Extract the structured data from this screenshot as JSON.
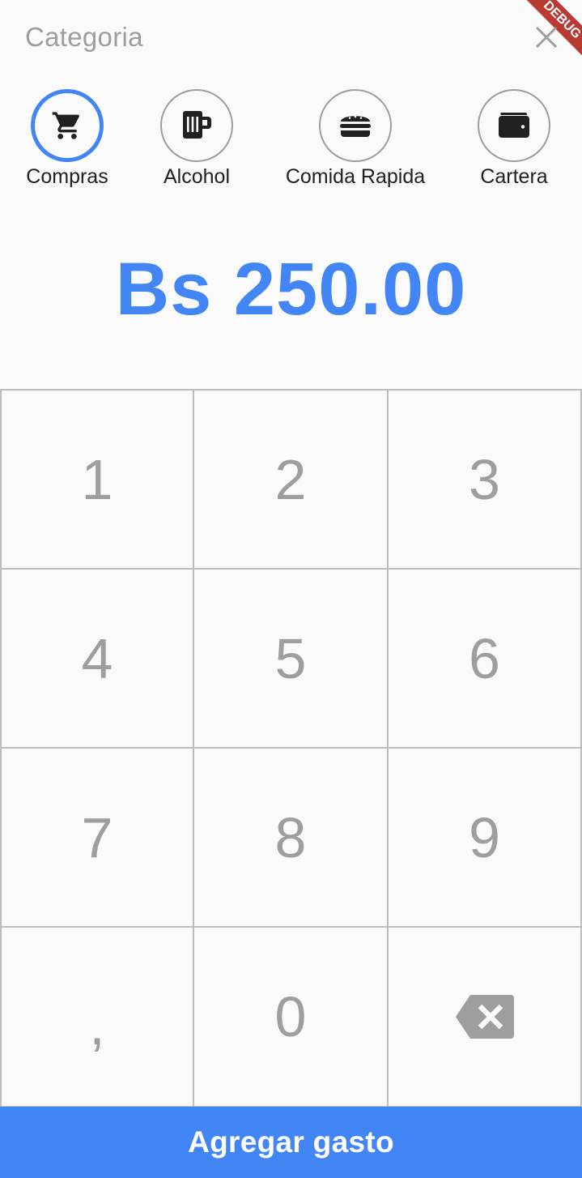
{
  "header": {
    "title": "Categoria",
    "close_icon": "close-icon"
  },
  "debug_banner": "DEBUG",
  "categories": [
    {
      "label": "Compras",
      "icon": "shopping-cart-icon",
      "selected": true
    },
    {
      "label": "Alcohol",
      "icon": "beer-mug-icon",
      "selected": false
    },
    {
      "label": "Comida Rapida",
      "icon": "hamburger-icon",
      "selected": false
    },
    {
      "label": "Cartera",
      "icon": "wallet-icon",
      "selected": false
    }
  ],
  "amount": "Bs 250.00",
  "keypad": {
    "keys": [
      "1",
      "2",
      "3",
      "4",
      "5",
      "6",
      "7",
      "8",
      "9",
      ",",
      "0"
    ],
    "backspace_icon": "backspace-icon"
  },
  "submit_label": "Agregar gasto",
  "colors": {
    "accent": "#4285f4",
    "muted": "#9e9e9e",
    "border": "#bdbdbd",
    "background": "#fafafa",
    "text": "#212121"
  }
}
